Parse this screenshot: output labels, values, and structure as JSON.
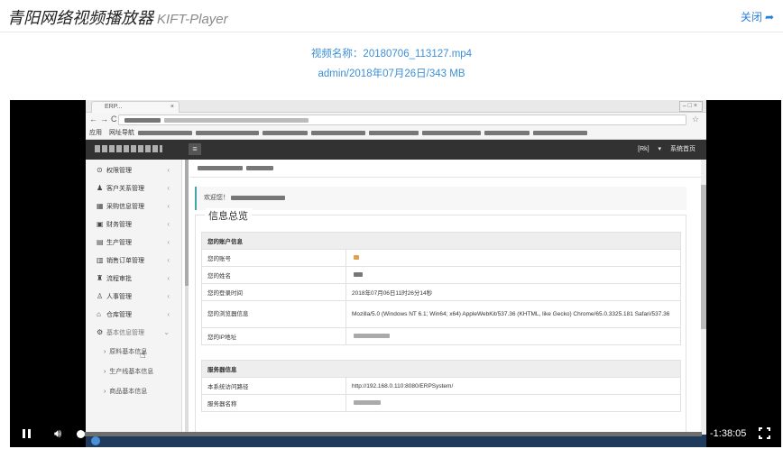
{
  "header": {
    "title_main": "青阳网络视频播放器",
    "title_sub": "KIFT-Player",
    "close_label": "关闭",
    "close_icon": "share-arrow-icon"
  },
  "video_info": {
    "name_line": "视频名称：20180706_113127.mp4",
    "detail_line": "admin/2018年07月26日/343 MB"
  },
  "screen": {
    "tab_label": "ERP...",
    "bookmarks_label": "应用",
    "bookmark2_label": "网址导航",
    "topbar_right": "[Rk] ▾ 系统首页",
    "sidebar_items": [
      {
        "icon": "shield-icon",
        "glyph": "⊙",
        "label": "权限管理"
      },
      {
        "icon": "users-icon",
        "glyph": "♟",
        "label": "客户关系管理"
      },
      {
        "icon": "grid-icon",
        "glyph": "▦",
        "label": "采购信息管理"
      },
      {
        "icon": "calendar-icon",
        "glyph": "▣",
        "label": "财务管理"
      },
      {
        "icon": "factory-icon",
        "glyph": "▤",
        "label": "生产管理"
      },
      {
        "icon": "list-icon",
        "glyph": "▥",
        "label": "销售订单管理"
      },
      {
        "icon": "flow-icon",
        "glyph": "♜",
        "label": "流程审批"
      },
      {
        "icon": "person-icon",
        "glyph": "♙",
        "label": "人事管理"
      },
      {
        "icon": "warehouse-icon",
        "glyph": "⌂",
        "label": "仓库管理"
      },
      {
        "icon": "gear-icon",
        "glyph": "⚙",
        "label": "基本信息管理"
      }
    ],
    "sidebar_subitems": [
      "原料基本信息",
      "生产线基本信息",
      "商品基本信息"
    ],
    "welcome": "欢迎您！",
    "section_title": "信息总览",
    "account_header": "您的账户信息",
    "account_rows": [
      {
        "k": "您的账号",
        "v": ""
      },
      {
        "k": "您的姓名",
        "v": ""
      },
      {
        "k": "您的登录时间",
        "v": "2018年07月06日11时26分14秒"
      },
      {
        "k": "您的浏览器信息",
        "v": "Mozilla/5.0 (Windows NT 6.1; Win64; x64) AppleWebKit/537.36 (KHTML, like Gecko) Chrome/65.0.3325.181 Safari/537.36"
      },
      {
        "k": "您的IP地址",
        "v": ""
      }
    ],
    "server_header": "服务器信息",
    "server_rows": [
      {
        "k": "本系统访问路径",
        "v": "http://192.168.0.110:8080/ERPSystem/"
      },
      {
        "k": "服务器名称",
        "v": ""
      }
    ]
  },
  "player": {
    "progress": 0.0,
    "time_remaining": "-1:38:05",
    "pause_icon": "pause-icon",
    "volume_icon": "volume-icon",
    "fullscreen_icon": "fullscreen-icon"
  }
}
